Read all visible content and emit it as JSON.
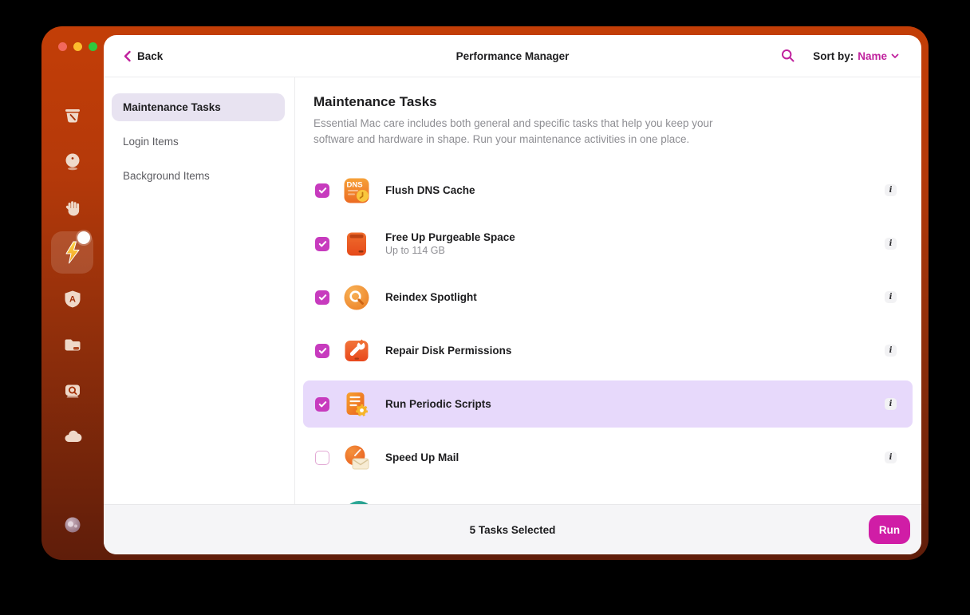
{
  "colors": {
    "accent_magenta": "#c0229e",
    "checkbox_magenta": "#c73bbe",
    "run_button": "#d01da6",
    "highlight_row": "#e7d9fb",
    "sidebar_top": "#c33e07",
    "sidebar_bottom": "#5f1d0a",
    "traffic": [
      "#f2685c",
      "#fcbc2d",
      "#2fc73e"
    ]
  },
  "header": {
    "back_label": "Back",
    "title": "Performance Manager",
    "sort_label": "Sort by:",
    "sort_value": "Name"
  },
  "sidebar": {
    "icons": [
      "cleanup",
      "protection",
      "privacy",
      "performance",
      "applications",
      "files",
      "space-lens",
      "cloud",
      "assistant"
    ],
    "active": "performance"
  },
  "nav": {
    "items": [
      {
        "label": "Maintenance Tasks",
        "selected": true
      },
      {
        "label": "Login Items",
        "selected": false
      },
      {
        "label": "Background Items",
        "selected": false
      }
    ]
  },
  "main": {
    "title": "Maintenance Tasks",
    "description": "Essential Mac care includes both general and specific tasks that help you keep your software and hardware in shape. Run your maintenance activities in one place.",
    "info_glyph": "i",
    "tasks": [
      {
        "label": "Flush DNS Cache",
        "checked": true,
        "highlighted": false,
        "icon": "dns-cache"
      },
      {
        "label": "Free Up Purgeable Space",
        "subtitle": "Up to 114 GB",
        "checked": true,
        "highlighted": false,
        "icon": "purgeable-space"
      },
      {
        "label": "Reindex Spotlight",
        "checked": true,
        "highlighted": false,
        "icon": "spotlight"
      },
      {
        "label": "Repair Disk Permissions",
        "checked": true,
        "highlighted": false,
        "icon": "disk-permissions"
      },
      {
        "label": "Run Periodic Scripts",
        "checked": true,
        "highlighted": true,
        "icon": "periodic-scripts"
      },
      {
        "label": "Speed Up Mail",
        "checked": false,
        "highlighted": false,
        "icon": "speed-up-mail"
      }
    ]
  },
  "footer": {
    "status": "5 Tasks Selected",
    "run_label": "Run"
  }
}
